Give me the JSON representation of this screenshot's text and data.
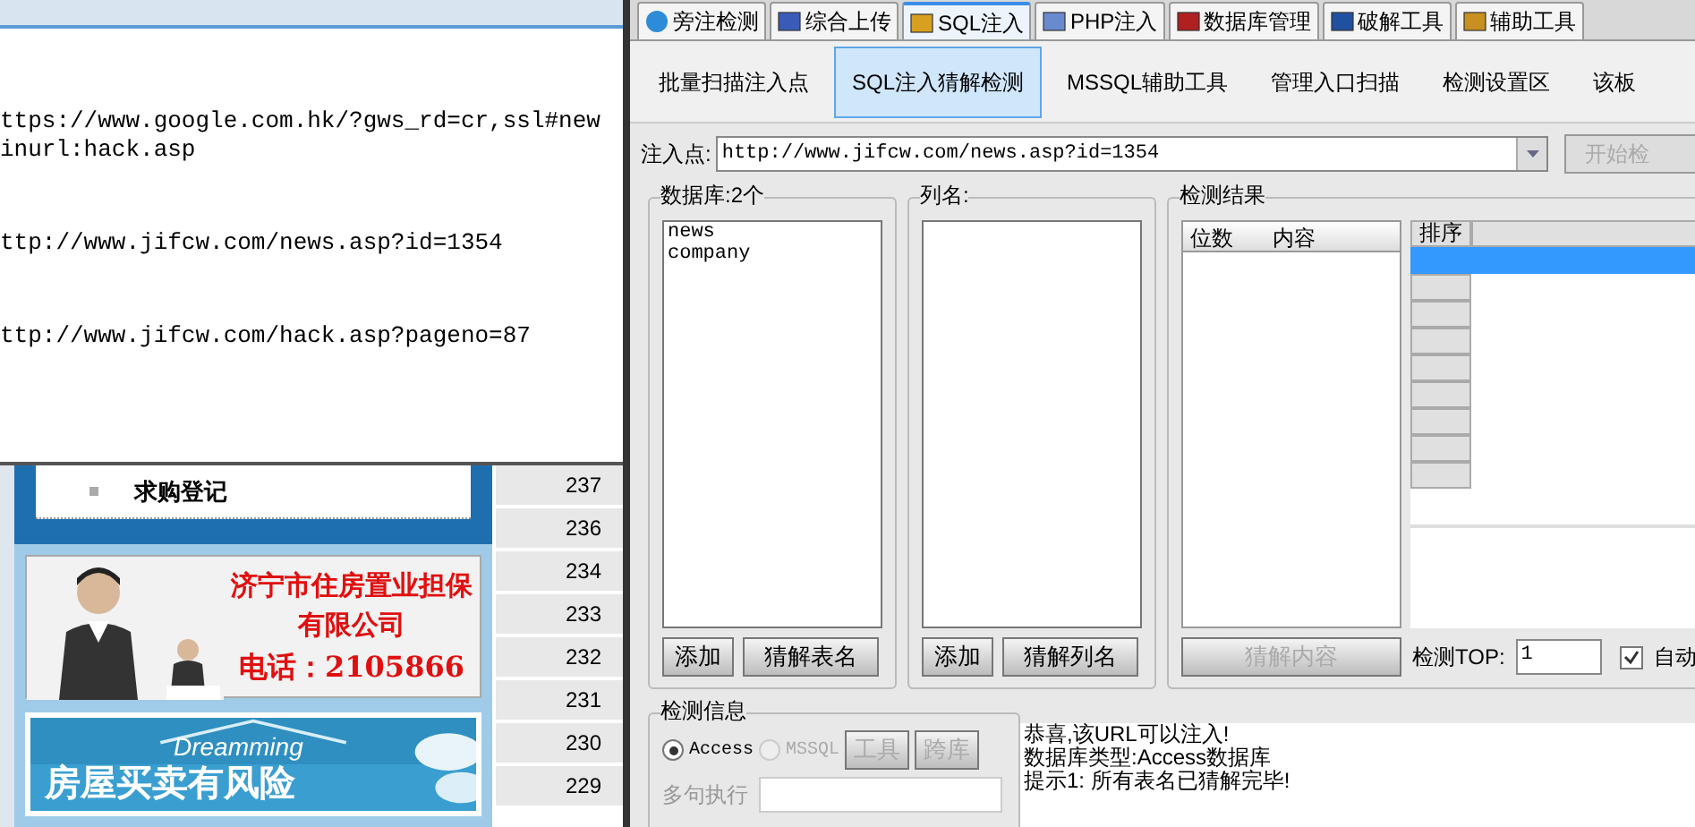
{
  "editor": {
    "blocks": [
      [
        "ttps://www.google.com.hk/?gws_rd=cr,ssl#new",
        "inurl:hack.asp"
      ],
      [
        "ttp://www.jifcw.com/news.asp?id=1354"
      ],
      [
        "ttp://www.jifcw.com/hack.asp?pageno=87"
      ]
    ]
  },
  "webpage": {
    "menu_item": "求购登记",
    "banner": {
      "lines": [
        "济宁市住房置业担保",
        "有限公司",
        "电话：2105866"
      ]
    },
    "banner2": {
      "caption": "Dreamming",
      "headline": "房屋买卖有风险"
    },
    "numbers": [
      "237",
      "236",
      "234",
      "233",
      "232",
      "231",
      "230",
      "229"
    ]
  },
  "tool": {
    "tabs": [
      {
        "label": "旁注检测",
        "selected": false
      },
      {
        "label": "综合上传",
        "selected": false
      },
      {
        "label": "SQL注入",
        "selected": true
      },
      {
        "label": "PHP注入",
        "selected": false
      },
      {
        "label": "数据库管理",
        "selected": false
      },
      {
        "label": "破解工具",
        "selected": false
      },
      {
        "label": "辅助工具",
        "selected": false
      }
    ],
    "subtabs": [
      {
        "label": "批量扫描注入点",
        "selected": false
      },
      {
        "label": "SQL注入猜解检测",
        "selected": true
      },
      {
        "label": "MSSQL辅助工具",
        "selected": false
      },
      {
        "label": "管理入口扫描",
        "selected": false
      },
      {
        "label": "检测设置区",
        "selected": false
      },
      {
        "label": "该板",
        "selected": false
      }
    ],
    "inject": {
      "label": "注入点:",
      "value": "http://www.jifcw.com/news.asp?id=1354",
      "button": "开始检"
    },
    "databases": {
      "title": "数据库:2个",
      "items": [
        "news",
        "company"
      ],
      "buttons": [
        {
          "label": "添加",
          "disabled": false
        },
        {
          "label": "猜解表名",
          "disabled": false
        }
      ]
    },
    "columns": {
      "title": "列名:",
      "buttons": [
        {
          "label": "添加",
          "disabled": false
        },
        {
          "label": "猜解列名",
          "disabled": false
        }
      ]
    },
    "results": {
      "title": "检测结果",
      "headers": [
        "位数",
        "内容"
      ],
      "sort_header": "排序",
      "button": {
        "label": "猜解内容",
        "disabled": true
      },
      "top_label": "检测TOP:",
      "top_value": "1",
      "auto": {
        "label": "自动",
        "checked": true
      }
    },
    "info": {
      "title": "检测信息",
      "radios": [
        {
          "label": "Access",
          "selected": true,
          "disabled": false
        },
        {
          "label": "MSSQL",
          "selected": false,
          "disabled": true
        }
      ],
      "buttons": [
        {
          "label": "工具",
          "disabled": true
        },
        {
          "label": "跨库",
          "disabled": true
        }
      ],
      "field_label": "多句执行",
      "output": [
        "恭喜,该URL可以注入!",
        "数据库类型:Access数据库",
        "提示1: 所有表名已猜解完毕!"
      ]
    }
  }
}
